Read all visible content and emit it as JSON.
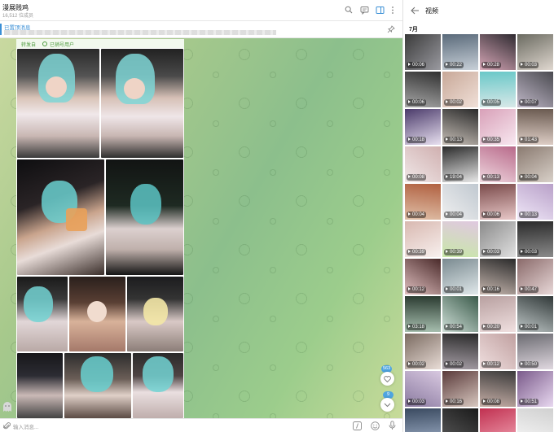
{
  "chat": {
    "title": "漫展贱鸡",
    "subscribers": "16,512 位成员",
    "pinned_label": "已置顶消息",
    "forwarded_label": "转发自",
    "forwarded_from": "已销号用户",
    "input_placeholder": "输入消息...",
    "badges": {
      "reactions": "563",
      "unread": "9"
    }
  },
  "header_icons": [
    "search-icon",
    "comments-icon",
    "sidebar-toggle-icon",
    "more-icon"
  ],
  "panel": {
    "title": "视频",
    "month": "7月",
    "videos": [
      {
        "duration": "00:06"
      },
      {
        "duration": "00:22"
      },
      {
        "duration": "00:28"
      },
      {
        "duration": "00:03"
      },
      {
        "duration": "00:06"
      },
      {
        "duration": "00:02"
      },
      {
        "duration": "00:05"
      },
      {
        "duration": "00:07"
      },
      {
        "duration": "00:18"
      },
      {
        "duration": "00:13"
      },
      {
        "duration": "00:35"
      },
      {
        "duration": "01:43"
      },
      {
        "duration": "00:08"
      },
      {
        "duration": "19:04"
      },
      {
        "duration": "00:13"
      },
      {
        "duration": "00:04"
      },
      {
        "duration": "00:04"
      },
      {
        "duration": "00:04"
      },
      {
        "duration": "00:06"
      },
      {
        "duration": "00:13"
      },
      {
        "duration": "00:39"
      },
      {
        "duration": "00:39"
      },
      {
        "duration": "00:03"
      },
      {
        "duration": "00:03"
      },
      {
        "duration": "00:12"
      },
      {
        "duration": "00:01"
      },
      {
        "duration": "00:16"
      },
      {
        "duration": "00:47"
      },
      {
        "duration": "03:18"
      },
      {
        "duration": "00:54"
      },
      {
        "duration": "00:20"
      },
      {
        "duration": "00:01"
      },
      {
        "duration": "00:02"
      },
      {
        "duration": "00:02"
      },
      {
        "duration": "00:12"
      },
      {
        "duration": "00:50"
      },
      {
        "duration": "00:03"
      },
      {
        "duration": "00:16"
      },
      {
        "duration": "00:08"
      },
      {
        "duration": "00:51"
      },
      {
        "duration": ""
      },
      {
        "duration": ""
      },
      {
        "duration": ""
      },
      {
        "duration": ""
      }
    ]
  },
  "colors": {
    "accent": "#3a8fd6",
    "forward_green": "#4c9a3c",
    "badge_blue": "#4ea4e0",
    "wallpaper_green": "#8cbf8c"
  }
}
